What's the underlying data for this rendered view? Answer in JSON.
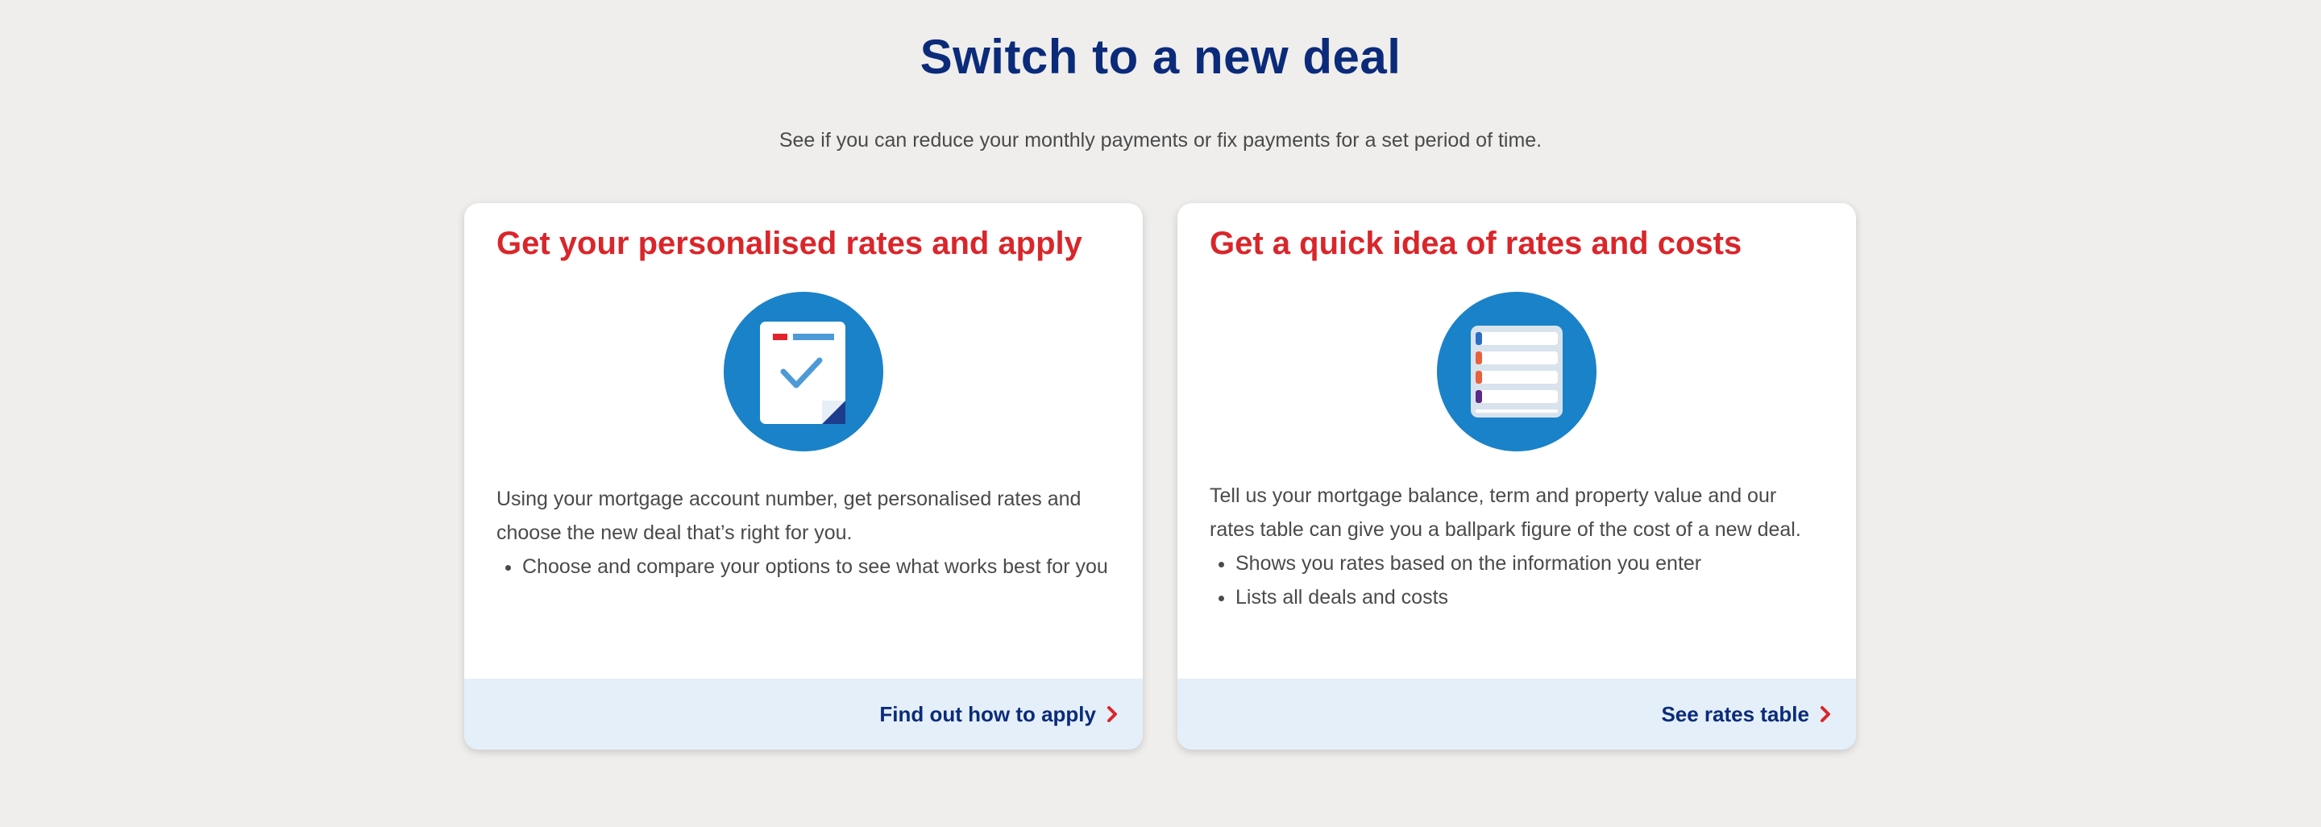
{
  "header": {
    "title": "Switch to a new deal",
    "subtitle": "See if you can reduce your monthly payments or fix payments for a set period of time."
  },
  "cards": [
    {
      "title": "Get your personalised rates and apply",
      "icon": "document-check-icon",
      "description": "Using your mortgage account number, get personalised rates and choose the new deal that’s right for you.",
      "bullets": [
        "Choose and compare your options to see what works best for you"
      ],
      "link_label": "Find out how to apply"
    },
    {
      "title": "Get a quick idea of rates and costs",
      "icon": "rates-list-icon",
      "description": "Tell us your mortgage balance, term and property value and our rates table can give you a ballpark figure of the cost of a new deal.",
      "bullets": [
        "Shows you rates based on the information you enter",
        "Lists all deals and costs"
      ],
      "link_label": "See rates table"
    }
  ],
  "colors": {
    "title_navy": "#0b2b7a",
    "card_title_red": "#d9262b",
    "icon_blue": "#1a82c8",
    "footer_bg": "#e4eff9"
  }
}
